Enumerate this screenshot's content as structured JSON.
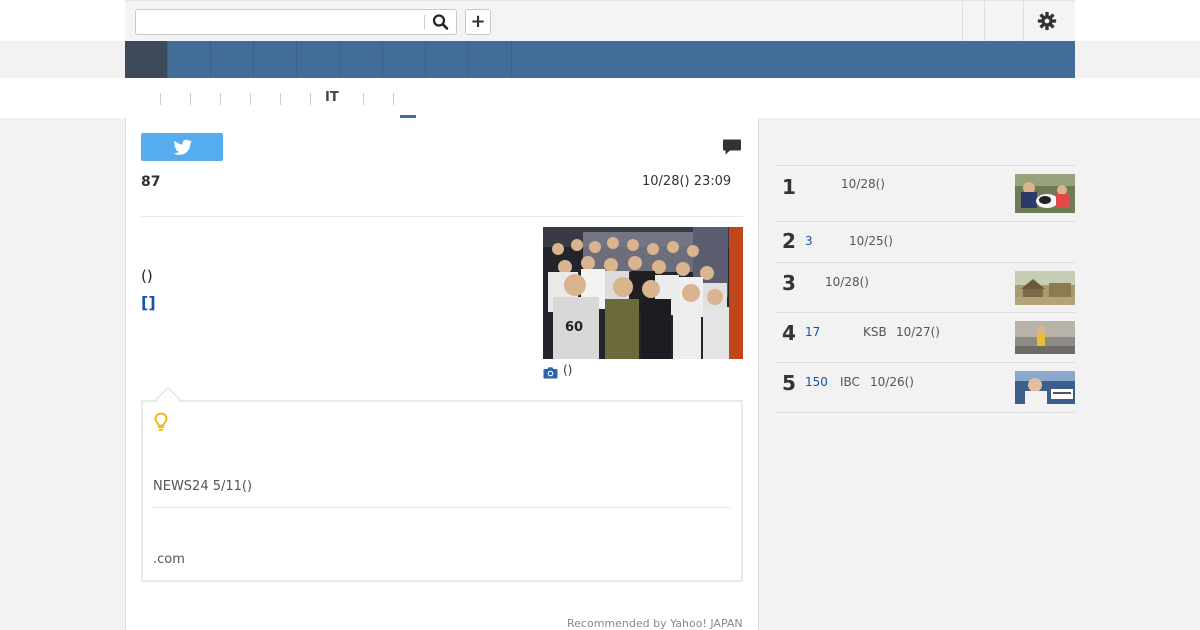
{
  "topbar": {
    "search_placeholder": "",
    "plus_label": "+"
  },
  "subnav": {
    "active_label": "IT"
  },
  "article": {
    "comment_count": "87",
    "date": "10/28() 23:09",
    "body_paren": "()",
    "body_bracket": "[]",
    "photo_caption": "()",
    "photo_jersey_number": "60"
  },
  "tip": {
    "news_line": "NEWS24 5/11()",
    "com_line": ".com",
    "recommended": "Recommended by Yahoo! JAPAN"
  },
  "ranking": [
    {
      "rank": "1",
      "count": "",
      "source": "",
      "date": "10/28()"
    },
    {
      "rank": "2",
      "count": "3",
      "source": "",
      "date": "10/25()"
    },
    {
      "rank": "3",
      "count": "",
      "source": "",
      "date": "10/28()"
    },
    {
      "rank": "4",
      "count": "17",
      "source": "KSB",
      "date": "10/27()"
    },
    {
      "rank": "5",
      "count": "150",
      "source": "IBC",
      "date": "10/26()"
    }
  ],
  "colors": {
    "nav_blue": "#426d98",
    "nav_active": "#3c4a5a",
    "twitter": "#55acee",
    "link_blue": "#1a4fb5",
    "bulb_yellow": "#f0b400"
  },
  "icons": [
    "search-icon",
    "plus-icon",
    "gear-icon",
    "twitter-icon",
    "comment-icon",
    "camera-icon",
    "bulb-icon"
  ]
}
